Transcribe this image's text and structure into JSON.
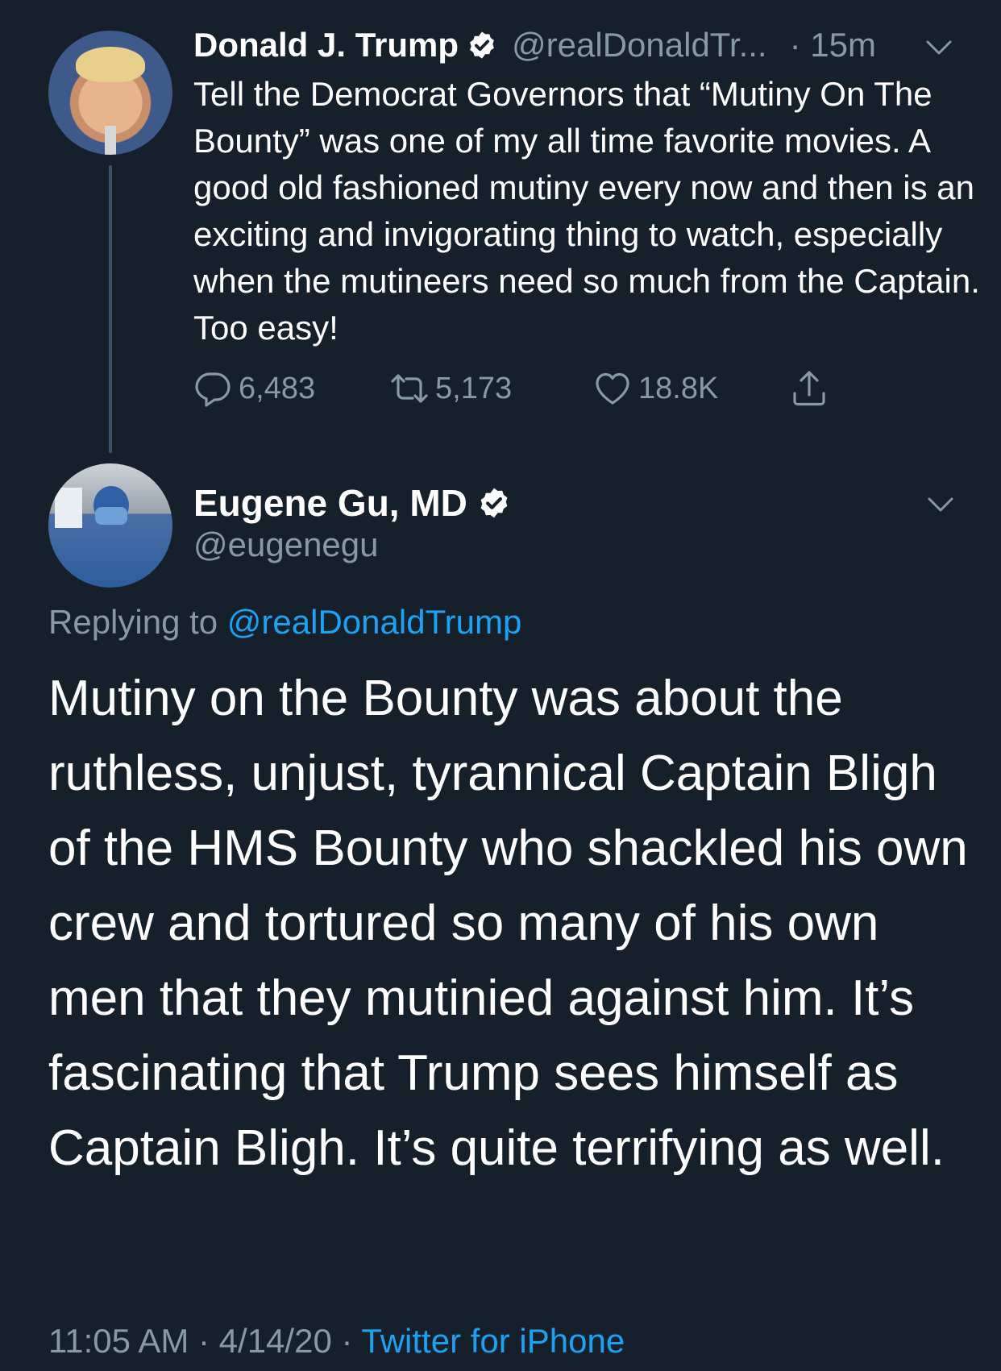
{
  "parent_tweet": {
    "display_name": "Donald J. Trump",
    "handle": "@realDonaldTr...",
    "time": "· 15m",
    "text": "Tell the Democrat Governors that “Mutiny On The Bounty” was one of my all time favorite movies. A good old fashioned mutiny every now and then is an exciting and invigorating thing to watch, especially when the mutineers need so much from the Captain. Too easy!",
    "replies": "6,483",
    "retweets": "5,173",
    "likes": "18.8K"
  },
  "reply_tweet": {
    "display_name": "Eugene Gu, MD",
    "handle": "@eugenegu",
    "replying_prefix": "Replying to ",
    "replying_to": "@realDonaldTrump",
    "text": "Mutiny on the Bounty was about the ruthless, unjust, tyrannical Captain Bligh of the HMS Bounty who shackled his own crew and tortured so many of his own men that they mutinied against him. It’s fascinating that Trump sees himself as Captain Bligh. It’s quite terrifying as well.",
    "time": "11:05 AM",
    "date": "4/14/20",
    "separator": " · ",
    "source": "Twitter for iPhone"
  },
  "colors": {
    "background": "#15202b",
    "text": "#ffffff",
    "secondary": "#8899a6",
    "link": "#1da1f2",
    "thread_line": "#3d5466"
  }
}
